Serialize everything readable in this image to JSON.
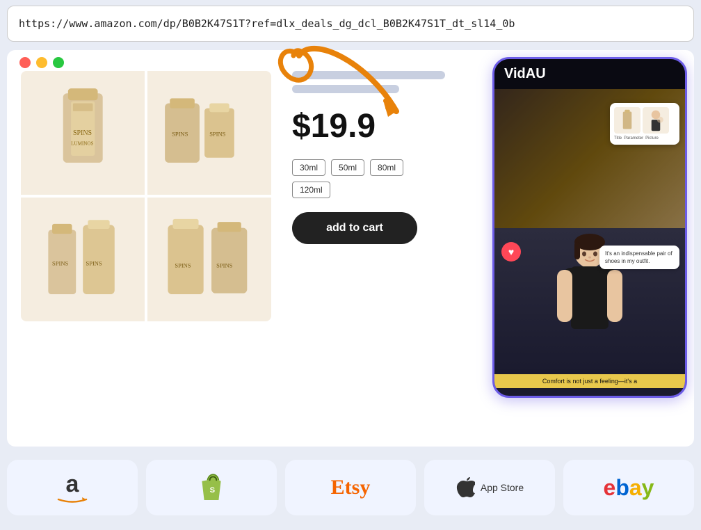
{
  "url_bar": {
    "url": "https://www.amazon.com/dp/B0B2K47S1T?ref=dlx_deals_dg_dcl_B0B2K47S1T_dt_sl14_0b"
  },
  "window_dots": {
    "red": "#ff5f57",
    "yellow": "#febc2e",
    "green": "#28c840"
  },
  "product": {
    "price": "$19.9",
    "sizes": [
      "30ml",
      "50ml",
      "80ml",
      "120ml"
    ],
    "add_to_cart": "add to cart"
  },
  "vidau": {
    "logo": "VidAU",
    "speech_text": "It's an indispensable pair of shoes in my outfit.",
    "subtitle": "Comfort is not just a feeling—it's a",
    "floating_labels": [
      "Title",
      "Parameter",
      "Picture"
    ]
  },
  "platforms": [
    {
      "id": "amazon",
      "label": "amazon"
    },
    {
      "id": "shopify",
      "label": "shopify"
    },
    {
      "id": "etsy",
      "label": "Etsy"
    },
    {
      "id": "appstore",
      "label": "App Store"
    },
    {
      "id": "ebay",
      "label": "ebay"
    }
  ]
}
